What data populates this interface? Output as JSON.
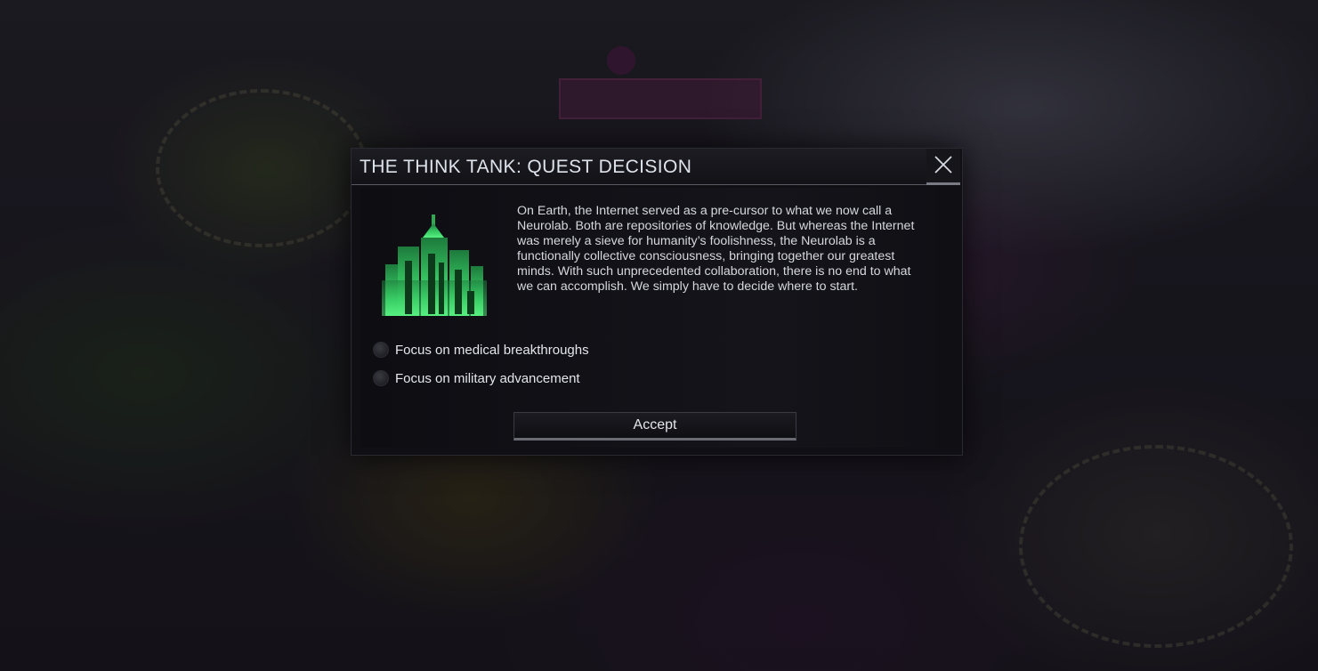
{
  "dialog": {
    "title": "THE THINK TANK: QUEST DECISION",
    "close_icon": "close-x-icon",
    "quest_icon": "neurolab-city-icon",
    "description": "On Earth, the Internet served as a pre-cursor to what we now call a Neurolab. Both are repositories of knowledge. But whereas the Internet was merely a sieve for humanity’s foolishness, the Neurolab is a functionally collective consciousness, bringing together our greatest minds. With such unprecedented collaboration, there is no end to what we can accomplish. We simply have to decide where to start.",
    "options": [
      {
        "label": "Focus on medical breakthroughs",
        "selected": false
      },
      {
        "label": "Focus on military advancement",
        "selected": false
      }
    ],
    "accept_label": "Accept"
  },
  "colors": {
    "icon_green": "#3fe070",
    "panel_bg": "#0f0f14",
    "text": "#d6d8de"
  }
}
